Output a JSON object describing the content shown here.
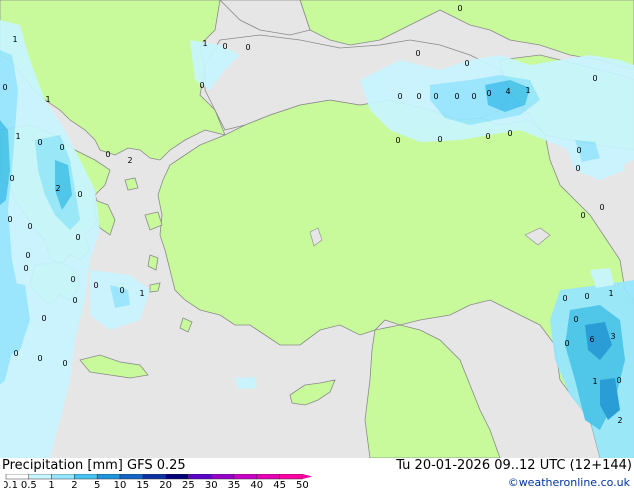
{
  "colors": {
    "sea": "#e6e6e6",
    "land": "#c8fa9b",
    "precip_light": "#c8f5ff",
    "precip_1": "#96e6ff",
    "precip_2": "#46c3f0",
    "precip_5": "#1e96dc"
  },
  "footer": {
    "product": "Precipitation [mm]  GFS 0.25",
    "datetime": "Tu 20-01-2026 09..12 UTC (12+144)",
    "credit": "©weatheronline.co.uk"
  },
  "legend": {
    "ticks": [
      "0.1",
      "0.5",
      "1",
      "2",
      "5",
      "10",
      "15",
      "20",
      "25",
      "30",
      "35",
      "40",
      "45",
      "50"
    ],
    "colors": [
      "#ffffff",
      "#c8f5ff",
      "#96e6ff",
      "#46c3f0",
      "#1e96dc",
      "#1464c8",
      "#0a32a0",
      "#000078",
      "#5a00c8",
      "#9600c8",
      "#c800c8",
      "#e600b4",
      "#ff00a0"
    ]
  },
  "map_values": [
    {
      "text": "0"
    },
    {
      "text": "1"
    },
    {
      "text": "0"
    },
    {
      "text": "0"
    },
    {
      "text": "0"
    },
    {
      "text": "0"
    },
    {
      "text": "0"
    },
    {
      "text": "0"
    },
    {
      "text": "0"
    },
    {
      "text": "0"
    },
    {
      "text": "0"
    },
    {
      "text": "0"
    },
    {
      "text": "4"
    },
    {
      "text": "1"
    },
    {
      "text": "0"
    },
    {
      "text": "0"
    },
    {
      "text": "0"
    },
    {
      "text": "0"
    },
    {
      "text": "0"
    },
    {
      "text": "0"
    },
    {
      "text": "1"
    },
    {
      "text": "0"
    },
    {
      "text": "0"
    },
    {
      "text": "0"
    },
    {
      "text": "2"
    },
    {
      "text": "0"
    },
    {
      "text": "2"
    },
    {
      "text": "0"
    },
    {
      "text": "0"
    },
    {
      "text": "0"
    },
    {
      "text": "0"
    },
    {
      "text": "0"
    },
    {
      "text": "0"
    },
    {
      "text": "0"
    },
    {
      "text": "0"
    },
    {
      "text": "0"
    },
    {
      "text": "0"
    },
    {
      "text": "1"
    },
    {
      "text": "0"
    },
    {
      "text": "1"
    },
    {
      "text": "0"
    },
    {
      "text": "1"
    },
    {
      "text": "0"
    },
    {
      "text": "0"
    },
    {
      "text": "0"
    },
    {
      "text": "0"
    },
    {
      "text": "0"
    },
    {
      "text": "0"
    },
    {
      "text": "0"
    },
    {
      "text": "0"
    },
    {
      "text": "1"
    },
    {
      "text": "0"
    },
    {
      "text": "0"
    },
    {
      "text": "6"
    },
    {
      "text": "3"
    },
    {
      "text": "1"
    },
    {
      "text": "2"
    },
    {
      "text": "0"
    },
    {
      "text": "0"
    }
  ]
}
